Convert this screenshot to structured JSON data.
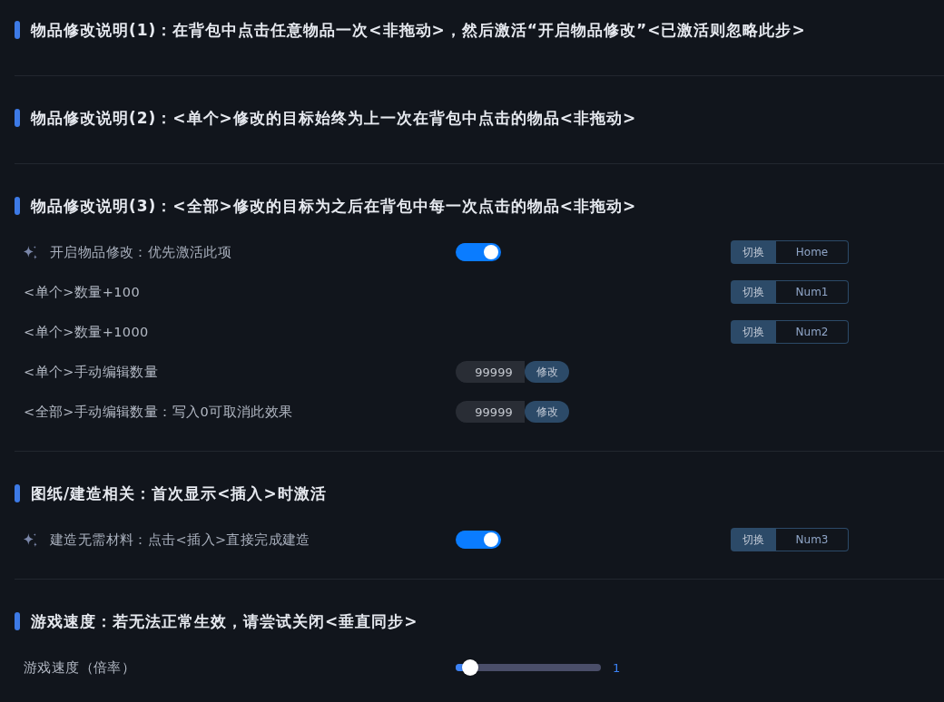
{
  "sections": [
    {
      "title": "物品修改说明(1)：在背包中点击任意物品一次<非拖动>，然后激活“开启物品修改”<已激活则忽略此步>"
    },
    {
      "title": "物品修改说明(2)：<单个>修改的目标始终为上一次在背包中点击的物品<非拖动>"
    },
    {
      "title": "物品修改说明(3)：<全部>修改的目标为之后在背包中每一次点击的物品<非拖动>",
      "rows": [
        {
          "kind": "toggle",
          "label": "开启物品修改：优先激活此项",
          "on": true,
          "hotkey": {
            "action": "切换",
            "key": "Home"
          }
        },
        {
          "kind": "hotkey",
          "label": "<单个>数量+100",
          "hotkey": {
            "action": "切换",
            "key": "Num1"
          }
        },
        {
          "kind": "hotkey",
          "label": "<单个>数量+1000",
          "hotkey": {
            "action": "切换",
            "key": "Num2"
          }
        },
        {
          "kind": "number",
          "label": "<单个>手动编辑数量",
          "value": "99999",
          "button": "修改"
        },
        {
          "kind": "number",
          "label": "<全部>手动编辑数量：写入0可取消此效果",
          "value": "99999",
          "button": "修改"
        }
      ]
    },
    {
      "title": "图纸/建造相关：首次显示<插入>时激活",
      "rows": [
        {
          "kind": "toggle",
          "label": "建造无需材料：点击<插入>直接完成建造",
          "on": true,
          "hotkey": {
            "action": "切换",
            "key": "Num3"
          }
        }
      ]
    },
    {
      "title": "游戏速度：若无法正常生效，请尝试关闭<垂直同步>",
      "rows": [
        {
          "kind": "slider",
          "label": "游戏速度（倍率）",
          "level": 0.1,
          "reading": "1"
        }
      ]
    }
  ]
}
